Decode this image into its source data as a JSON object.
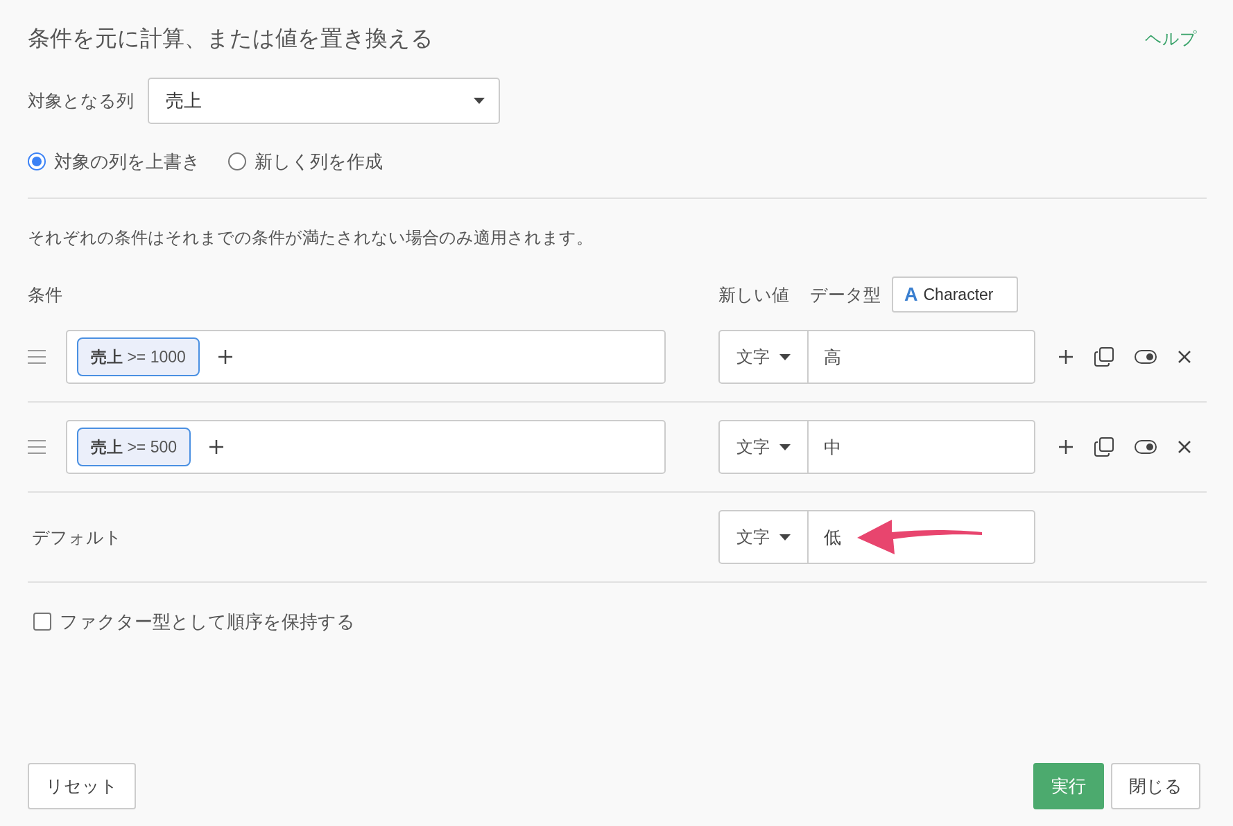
{
  "title": "条件を元に計算、または値を置き換える",
  "help_link": "ヘルプ",
  "target_column": {
    "label": "対象となる列",
    "value": "売上"
  },
  "output_mode": [
    {
      "label": "対象の列を上書き",
      "selected": true
    },
    {
      "label": "新しく列を作成",
      "selected": false
    }
  ],
  "description": "それぞれの条件はそれまでの条件が満たされない場合のみ適用されます。",
  "conditions_header": {
    "label": "条件",
    "new_value_label": "新しい値",
    "data_type_label": "データ型",
    "data_type_button": {
      "icon_letter": "A",
      "label": "Character"
    }
  },
  "conditions": [
    {
      "chips": [
        "**売上** >= 1000"
      ],
      "value_type": "文字",
      "value": "高",
      "enabled": true
    },
    {
      "chips": [
        "**売上** >= 500"
      ],
      "value_type": "文字",
      "value": "中",
      "enabled": true
    }
  ],
  "default": {
    "label": "デフォルト",
    "value_type": "文字",
    "value": "低"
  },
  "keep_factor_order": {
    "label": "ファクター型として順序を保持する",
    "checked": false
  },
  "buttons": [
    {
      "kind": "reset",
      "label": "リセット"
    },
    {
      "kind": "primary",
      "label": "実行"
    },
    {
      "kind": "secondary",
      "label": "閉じる"
    }
  ]
}
